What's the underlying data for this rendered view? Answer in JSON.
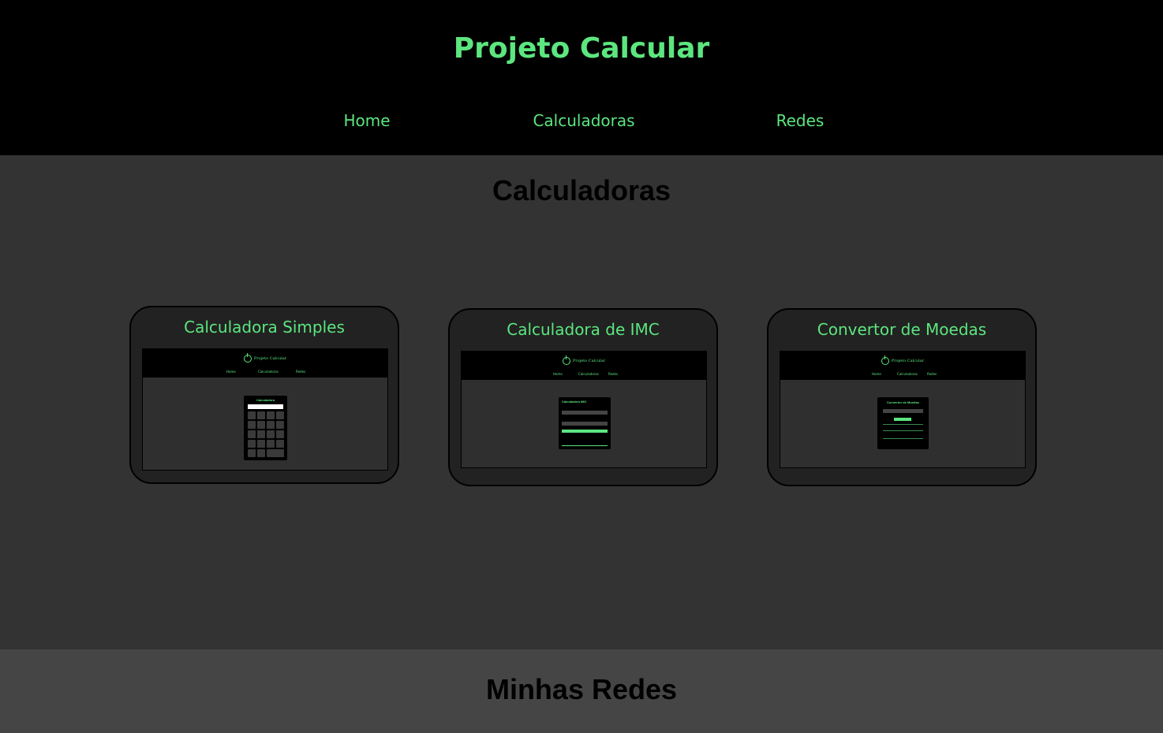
{
  "header": {
    "title": "Projeto Calcular",
    "nav": {
      "home": "Home",
      "calculadoras": "Calculadoras",
      "redes": "Redes"
    }
  },
  "calculadoras": {
    "title": "Calculadoras",
    "cards": [
      {
        "title": "Calculadora Simples"
      },
      {
        "title": "Calculadora de IMC"
      },
      {
        "title": "Convertor de Moedas"
      }
    ]
  },
  "redes": {
    "title": "Minhas Redes"
  },
  "colors": {
    "accent": "#5ce67f",
    "header_bg": "#000000",
    "section_bg": "#333333",
    "card_bg": "#222222",
    "footer_bg": "#454545"
  }
}
